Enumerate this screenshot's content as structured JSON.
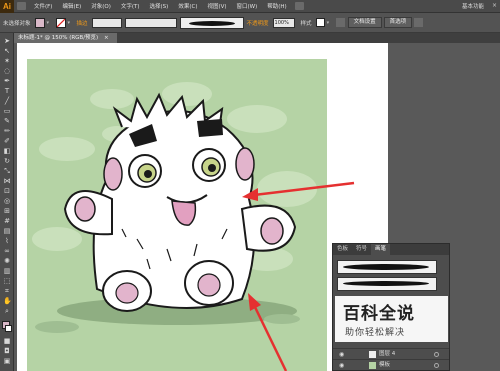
{
  "app": {
    "logo": "Ai",
    "workspace": "基本功能"
  },
  "menu": [
    "文件(F)",
    "编辑(E)",
    "对象(O)",
    "文字(T)",
    "选择(S)",
    "效果(C)",
    "视图(V)",
    "窗口(W)",
    "帮助(H)"
  ],
  "control_bar": {
    "selection": "未选择对象",
    "stroke_label": "描边",
    "opacity_label": "不透明度",
    "opacity_value": "100%",
    "style_label": "样式",
    "doc_setup_button": "文档设置",
    "preferences_button": "首选项"
  },
  "document_tab": {
    "title": "未标题-1* @ 150% (RGB/预览)",
    "close": "×"
  },
  "window_controls": {
    "minimize": "–",
    "maximize": "□",
    "close": "×"
  },
  "layers_panel": {
    "tabs": [
      "色板",
      "符号",
      "画笔"
    ],
    "active_tab": "画笔",
    "layers": [
      {
        "name": "图层 4"
      },
      {
        "name": "模板"
      }
    ]
  },
  "watermark": {
    "title": "百科全说",
    "subtitle": "助你轻松解决"
  },
  "colors": {
    "artboard_bg": "#b5d3a5",
    "arrow": "#e53030",
    "accent": "#f39b18"
  }
}
